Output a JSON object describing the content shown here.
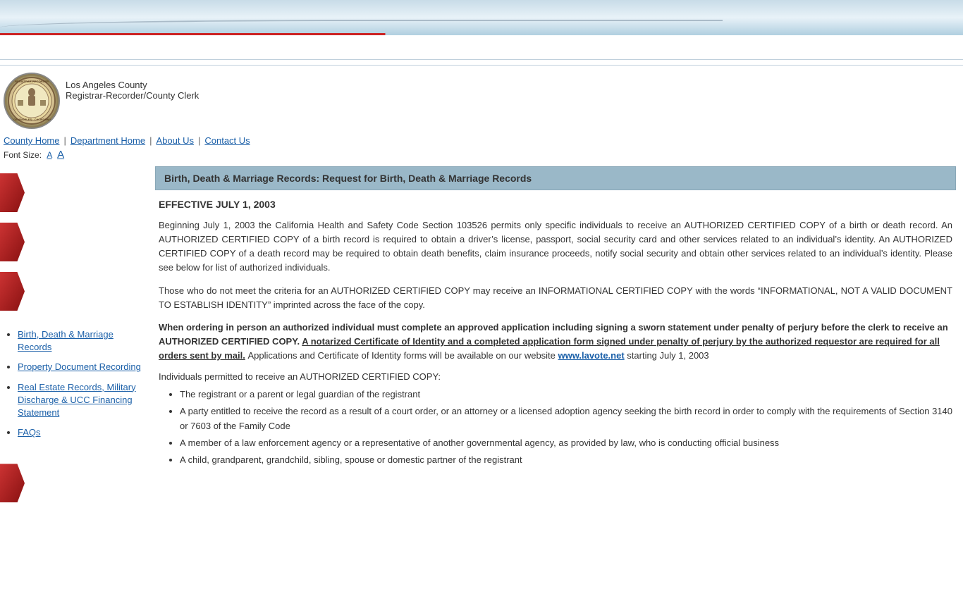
{
  "topBanner": {
    "visible": true
  },
  "org": {
    "name1": "Los Angeles County",
    "name2": "Registrar-Recorder/County Clerk",
    "seal_text": "REGISTRAR-RECORDER/COUNTY CLERK"
  },
  "nav": {
    "county_home": "County Home",
    "department_home": "Department Home",
    "about_us": "About Us",
    "contact_us": "Contact Us"
  },
  "fontsize": {
    "label": "Font Size:",
    "small_a": "A",
    "large_a": "A"
  },
  "content": {
    "title": "Birth, Death & Marriage Records: Request for Birth, Death & Marriage Records",
    "effective_date": "EFFECTIVE JULY 1, 2003",
    "para1": "Beginning July 1, 2003 the California Health and Safety Code Section 103526 permits only specific individuals to receive an AUTHORIZED CERTIFIED COPY of a birth or death record. An AUTHORIZED CERTIFIED COPY of a birth record is required to obtain a driver’s license, passport, social security card and other services related to an individual’s identity. An AUTHORIZED CERTIFIED COPY of a death record may be required to obtain death benefits, claim insurance proceeds, notify social security and obtain other services related to an individual’s identity. Please see below for list of authorized individuals.",
    "para2": "Those who do not meet the criteria for an AUTHORIZED CERTIFIED COPY may receive an INFORMATIONAL CERTIFIED COPY with the words “INFORMATIONAL, NOT A VALID DOCUMENT TO ESTABLISH IDENTITY” imprinted across the face of the copy.",
    "para3_bold_part": "When ordering in person an authorized individual must complete an approved application including signing a sworn statement under penalty of perjury before the clerk to receive an AUTHORIZED CERTIFIED COPY.",
    "para3_underline": "A notarized Certificate of Identity and a completed application form signed under penalty of perjury by the authorized requestor are required for all orders sent by mail.",
    "para3_normal": " Applications and Certificate of Identity forms will be available on our website ",
    "para3_link": "www.lavote.net",
    "para3_date": " starting July 1, 2003",
    "permitted_title": "Individuals permitted to receive an AUTHORIZED CERTIFIED COPY:",
    "bullets": [
      "The registrant or a parent or legal guardian of the registrant",
      "A party entitled to receive the record as a result of a court order, or an attorney or a licensed adoption agency seeking the birth record in order to comply with the requirements of Section 3140 or 7603 of the Family Code",
      "A member of a law enforcement agency or a representative of another governmental agency, as provided by law, who is conducting official business",
      "A child, grandparent, grandchild, sibling, spouse or domestic partner of the registrant"
    ]
  },
  "sidebar": {
    "links": [
      {
        "label": "Birth, Death & Marriage Records",
        "url": "#"
      },
      {
        "label": "Property Document Recording",
        "url": "#"
      },
      {
        "label": "Real Estate Records, Military Discharge & UCC Financing Statement",
        "url": "#"
      },
      {
        "label": "FAQs",
        "url": "#"
      }
    ]
  }
}
